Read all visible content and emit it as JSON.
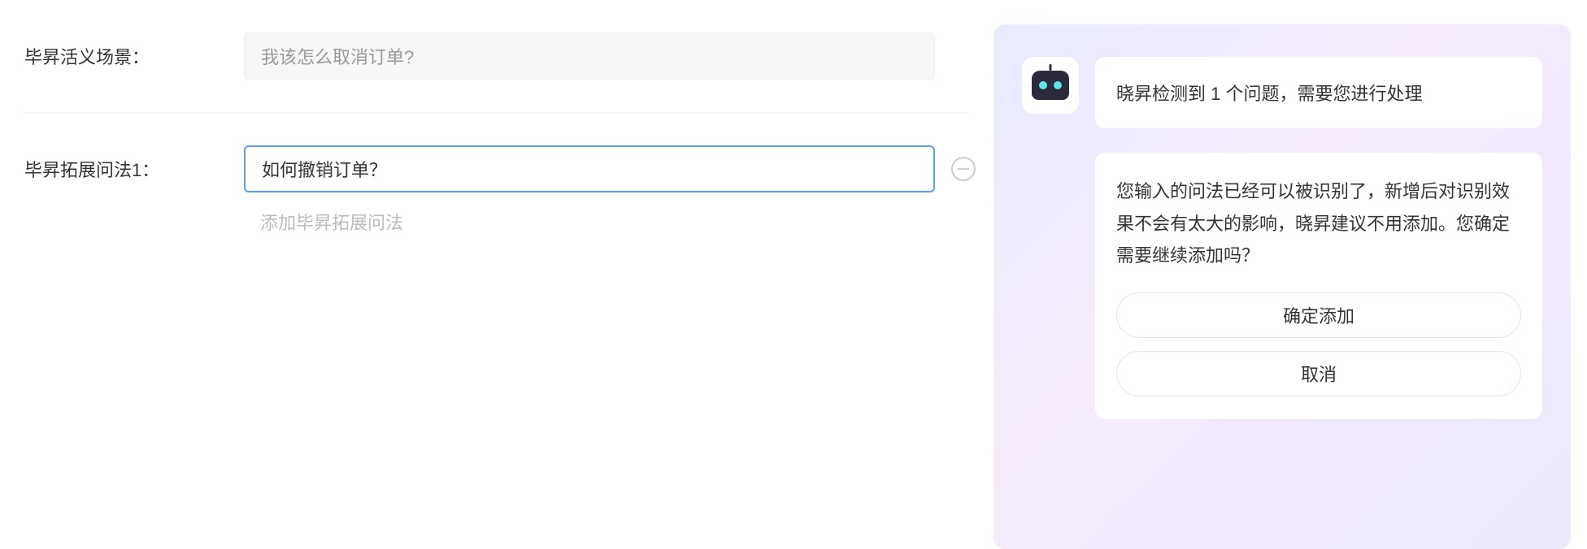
{
  "form": {
    "scenario": {
      "label": "毕昇活义场景：",
      "value": "我该怎么取消订单?"
    },
    "extension1": {
      "label": "毕昇拓展问法1：",
      "value": "如何撤销订单？"
    },
    "add_link": "添加毕昇拓展问法"
  },
  "assistant": {
    "title": "晓昇检测到 1 个问题，需要您进行处理",
    "message": "您输入的问法已经可以被识别了，新增后对识别效果不会有太大的影响，晓昇建议不用添加。您确定需要继续添加吗？",
    "confirm_label": "确定添加",
    "cancel_label": "取消"
  }
}
